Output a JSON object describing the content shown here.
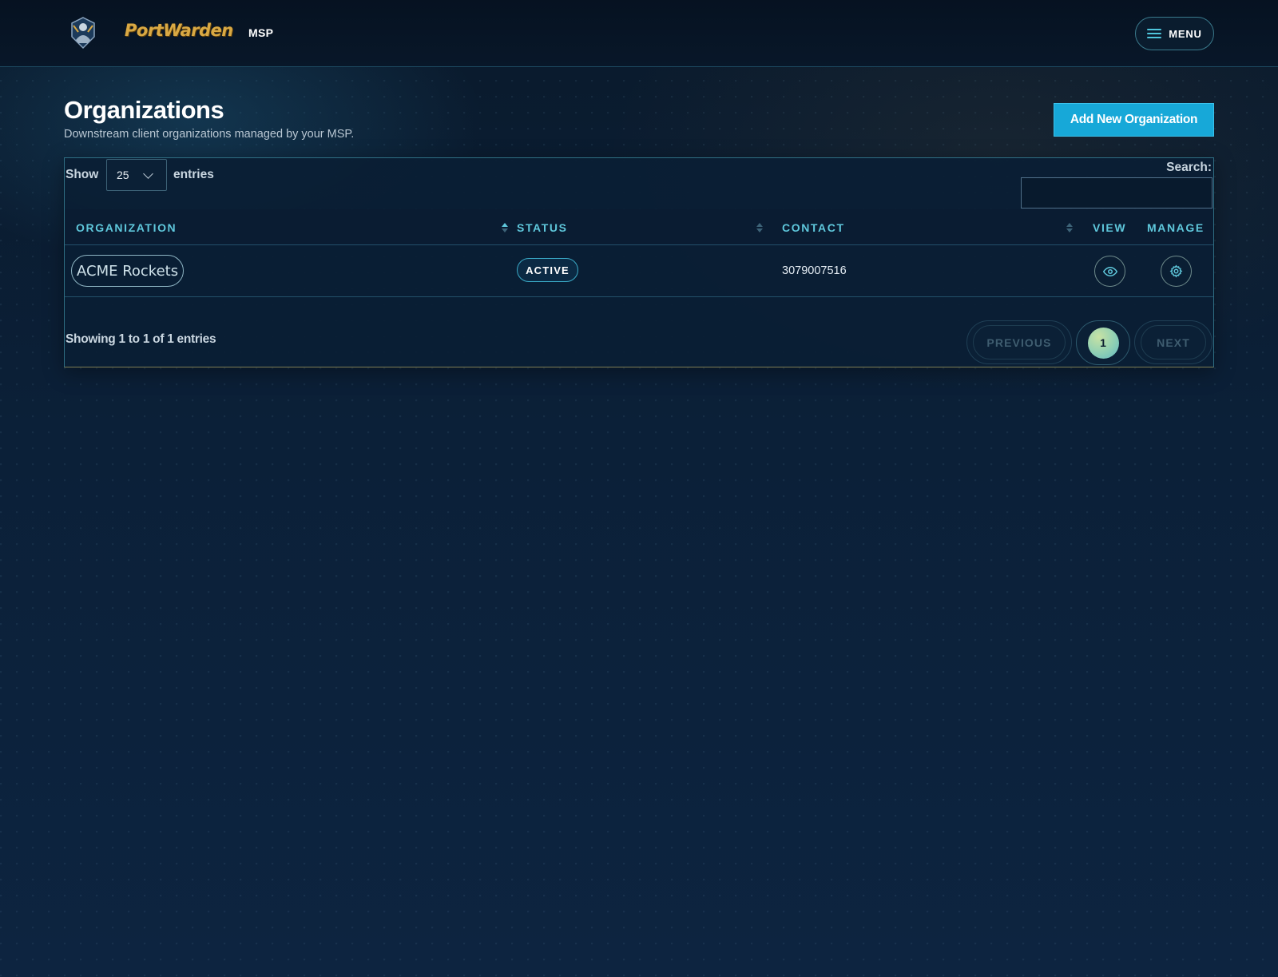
{
  "header": {
    "brand": "PortWarden",
    "section": "MSP",
    "menu_label": "MENU"
  },
  "page": {
    "title": "Organizations",
    "subtitle": "Downstream client organizations managed by your MSP.",
    "add_button": "Add New Organization"
  },
  "table_controls": {
    "show_label": "Show",
    "page_length": "25",
    "entries_label": "entries",
    "search_label": "Search:",
    "search_value": ""
  },
  "columns": [
    "ORGANIZATION",
    "STATUS",
    "CONTACT",
    "VIEW",
    "MANAGE"
  ],
  "rows": [
    {
      "organization": "ACME Rockets",
      "status": "ACTIVE",
      "contact": "3079007516"
    }
  ],
  "footer": {
    "info": "Showing 1 to 1 of 1 entries",
    "previous": "PREVIOUS",
    "current_page": "1",
    "next": "NEXT"
  },
  "colors": {
    "accent": "#17a8d8",
    "header_text": "#5fc8dc",
    "brand_gold": "#d9a944"
  },
  "icons": {
    "menu": "hamburger-icon",
    "view": "eye-icon",
    "manage": "gear-icon",
    "logo": "guardian-emblem-icon"
  }
}
